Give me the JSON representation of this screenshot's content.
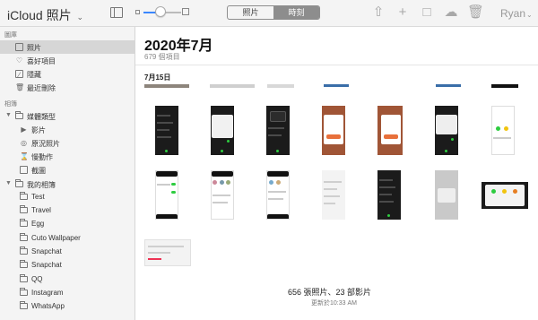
{
  "app": {
    "title": "iCloud",
    "app_name": "照片",
    "toolbar": {
      "view_segments": [
        {
          "label": "照片",
          "active": false
        },
        {
          "label": "時刻",
          "active": true
        }
      ],
      "zoom_level": 0.45,
      "tools": [
        "upload-icon",
        "add-icon",
        "share-icon",
        "download-icon",
        "trash-icon"
      ],
      "user": "Ryan"
    }
  },
  "sidebar": {
    "library_label": "圖庫",
    "library_items": [
      {
        "label": "照片",
        "icon": "photos-icon",
        "selected": true
      },
      {
        "label": "喜好項目",
        "icon": "heart-icon",
        "selected": false
      },
      {
        "label": "隱藏",
        "icon": "hidden-icon",
        "selected": false
      },
      {
        "label": "最近刪除",
        "icon": "trash-icon",
        "selected": false
      }
    ],
    "albums_label": "相簿",
    "media_group": {
      "label": "媒體類型",
      "expanded": true
    },
    "media_items": [
      {
        "label": "影片",
        "icon": "video-icon"
      },
      {
        "label": "原況照片",
        "icon": "live-photo-icon"
      },
      {
        "label": "慢動作",
        "icon": "slomo-icon"
      },
      {
        "label": "截圖",
        "icon": "screenshot-icon"
      }
    ],
    "my_albums_group": {
      "label": "我的相簿",
      "expanded": true
    },
    "my_albums": [
      "Test",
      "Travel",
      "Egg",
      "Cuto Wallpaper",
      "Snapchat",
      "Snapchat",
      "QQ",
      "Instagram",
      "WhatsApp"
    ]
  },
  "main": {
    "title": "2020年7月",
    "count": "679 個項目",
    "date": "7月15日",
    "footer_count": "656 張照片、23 部影片",
    "footer_updated": "更新於10:33 AM"
  },
  "colors": {
    "accent": "#3b87ff",
    "sidebar_bg": "#f4f4f4",
    "selected_row": "#d6d6d6",
    "segment_active": "#8d8d8d"
  }
}
